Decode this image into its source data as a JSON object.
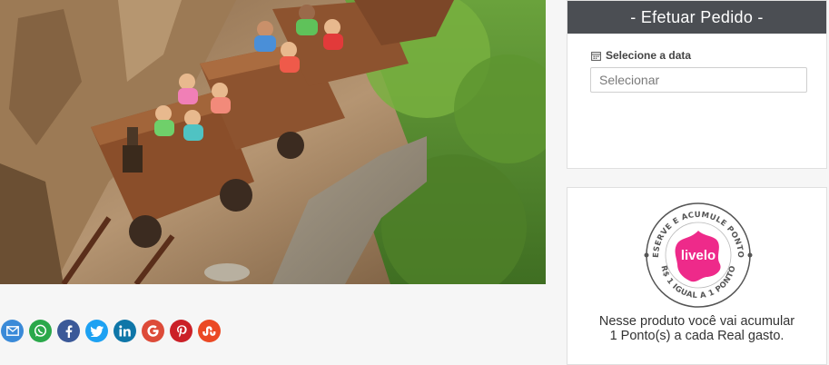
{
  "order": {
    "title": "- Efetuar Pedido -",
    "date_label": "Selecione a data",
    "date_placeholder": "Selecionar"
  },
  "livelo": {
    "badge_top_text": "RESERVE E ACUMULE PONTOS",
    "badge_bottom_text": "R$ 1 IGUAL A 1 PONTO",
    "logo_text": "livelo",
    "message_line1": "Nesse produto você vai acumular",
    "message_line2": "1 Ponto(s) a cada Real gasto."
  },
  "share": {
    "buttons": [
      {
        "name": "email",
        "color": "#3a8ad8"
      },
      {
        "name": "whatsapp",
        "color": "#2aa84a"
      },
      {
        "name": "facebook",
        "color": "#3b5998"
      },
      {
        "name": "twitter",
        "color": "#1da1f2"
      },
      {
        "name": "linkedin",
        "color": "#0e76a8"
      },
      {
        "name": "google",
        "color": "#dd4b39"
      },
      {
        "name": "pinterest",
        "color": "#cb2027"
      },
      {
        "name": "stumbleupon",
        "color": "#eb4924"
      }
    ]
  },
  "hero": {
    "image": "roller-coaster-mine-train-photo"
  }
}
